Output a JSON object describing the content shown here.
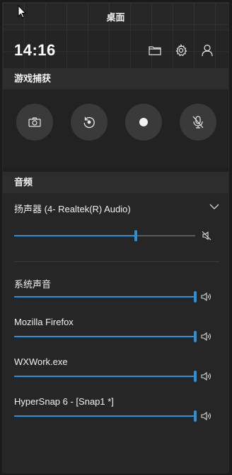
{
  "window": {
    "title": "桌面"
  },
  "header": {
    "time": "14:16",
    "icons": [
      "folder-icon",
      "gear-icon",
      "user-icon"
    ]
  },
  "capture": {
    "title": "游戏捕获",
    "buttons": [
      "camera-icon",
      "replay-icon",
      "record-icon",
      "mic-off-icon"
    ]
  },
  "audio": {
    "title": "音频",
    "device": {
      "label": "扬声器 (4- Realtek(R) Audio)",
      "volume_percent": 67,
      "muted_icon": "speaker-muted-icon"
    },
    "apps": [
      {
        "name": "系统声音",
        "volume_percent": 100
      },
      {
        "name": "Mozilla Firefox",
        "volume_percent": 100
      },
      {
        "name": "WXWork.exe",
        "volume_percent": 100
      },
      {
        "name": "HyperSnap 6 - [Snap1 *]",
        "volume_percent": 100
      }
    ]
  },
  "colors": {
    "accent": "#2d8fd6",
    "background": "#1f1f1f"
  }
}
